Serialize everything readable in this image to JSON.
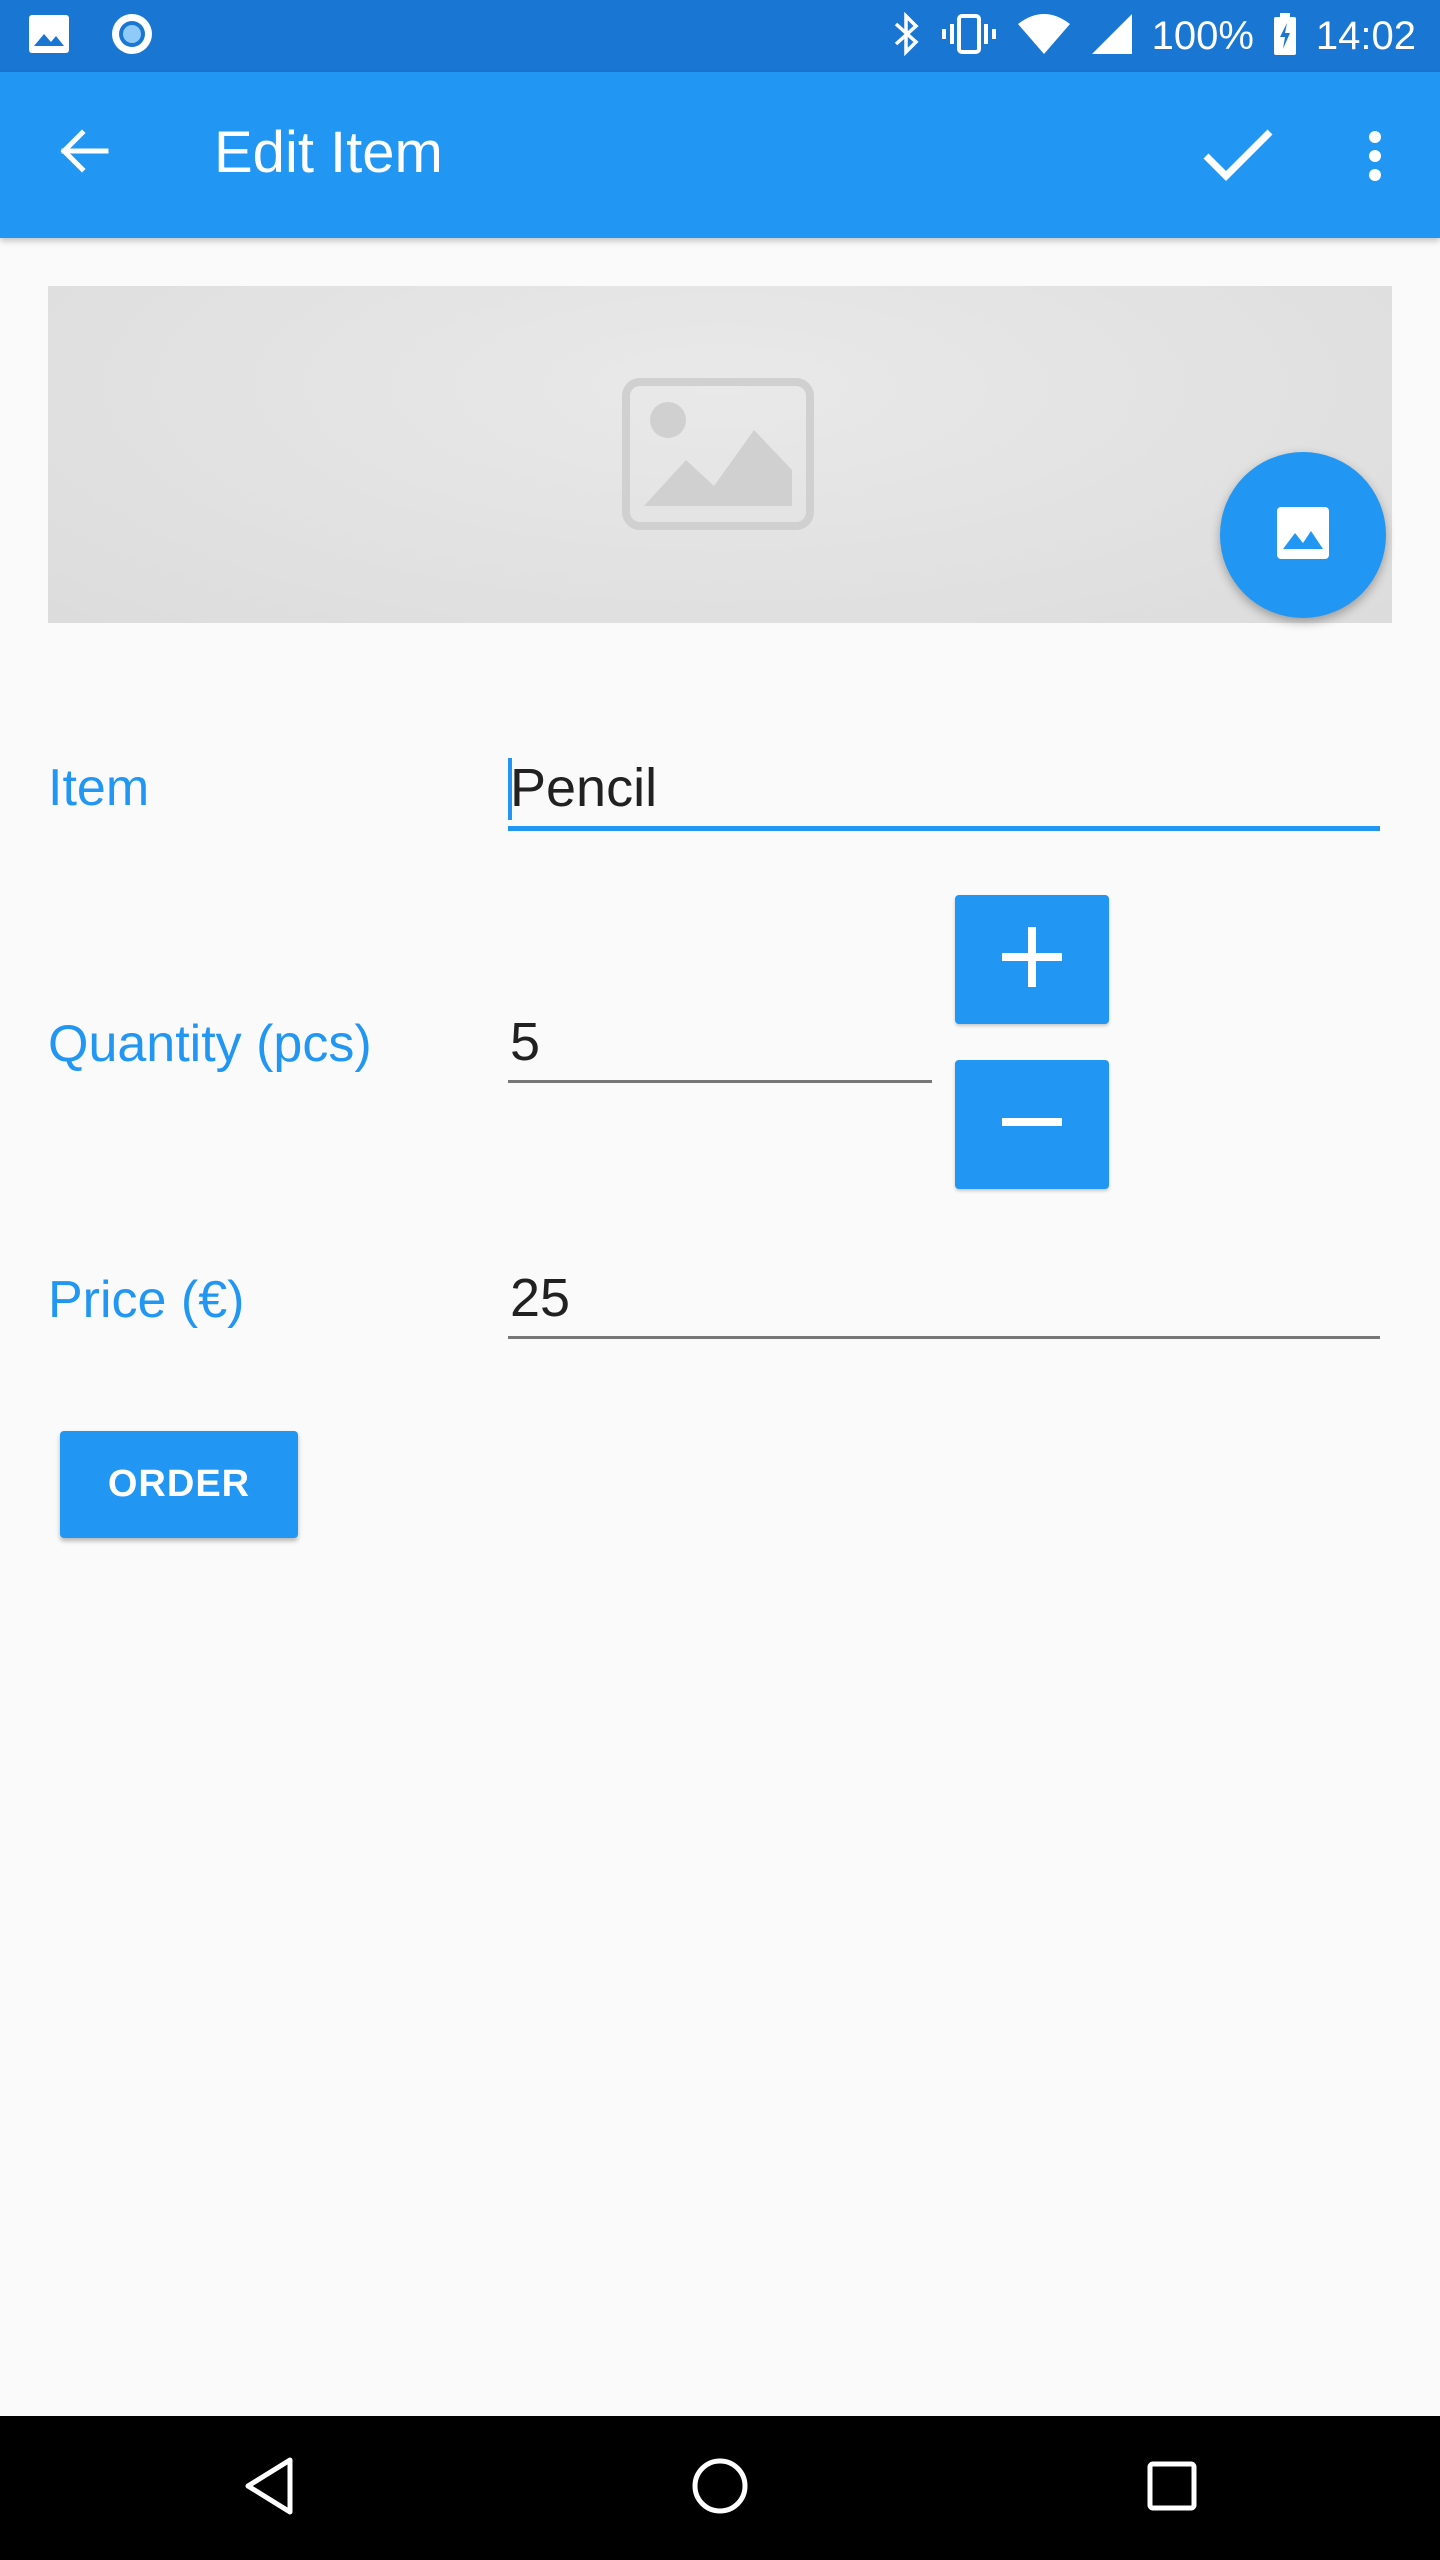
{
  "status_bar": {
    "battery": "100%",
    "time": "14:02",
    "icons": [
      "gallery-notification-icon",
      "record-notification-icon",
      "bluetooth-icon",
      "vibrate-icon",
      "wifi-icon",
      "signal-icon",
      "battery-charging-icon"
    ]
  },
  "app_bar": {
    "title": "Edit Item",
    "icons": [
      "back-arrow-icon",
      "check-icon",
      "overflow-menu-icon"
    ]
  },
  "image_section": {
    "placeholder_icon": "image-placeholder-icon",
    "fab_icon": "image-icon"
  },
  "form": {
    "item": {
      "label": "Item",
      "value": "Pencil"
    },
    "quantity": {
      "label": "Quantity (pcs)",
      "value": "5",
      "increment_icon": "plus-icon",
      "decrement_icon": "minus-icon"
    },
    "price": {
      "label": "Price (€)",
      "value": "25"
    },
    "order_button": "ORDER"
  },
  "nav_bar": {
    "icons": [
      "nav-back-icon",
      "nav-home-icon",
      "nav-recents-icon"
    ]
  },
  "colors": {
    "primary": "#2196f3",
    "primary_dark": "#1976d2",
    "background": "#fafafa",
    "text": "#212121"
  }
}
